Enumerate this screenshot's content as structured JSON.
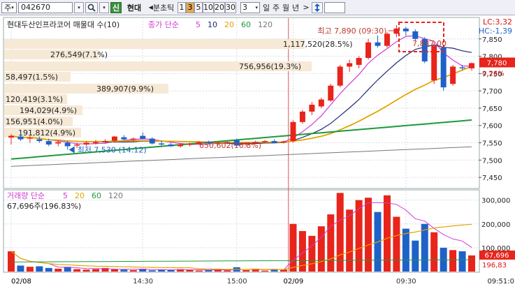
{
  "toolbar": {
    "market": "주",
    "code": "042670",
    "stock_name": "현대",
    "period_label": "분초틱",
    "intervals": [
      "1",
      "3",
      "5",
      "10",
      "20",
      "30"
    ],
    "active_interval": "3",
    "count_value": "3",
    "periods": [
      "일",
      "주",
      "월",
      "년"
    ],
    "more": ">",
    "sort_icon": "updown-arrows-icon",
    "credit_badge": "신",
    "prev_arrow": "◀"
  },
  "legend": {
    "title": "현대두산인프라코어 매물대 수(10)",
    "price_ma_label": "종가 단순",
    "price_ma_periods": [
      "5",
      "10",
      "20",
      "60",
      "120"
    ],
    "volume_label": "거래량 단순",
    "volume_ma_periods": [
      "5",
      "20",
      "60",
      "120"
    ],
    "volume_value": "67,696주(196.83%)"
  },
  "corner": {
    "lc": "LC:3,32",
    "hc": "HC:-1,39"
  },
  "annotations": {
    "high": "최고 7,890 (09:30)",
    "low": "최저 7,530 (14:12)",
    "current_price": "7,780",
    "current_change": "0.26%",
    "current_volume": "67,696",
    "volume_pct": "196,83",
    "big_label": "650,602(16.8%)",
    "high_box_label": "7,837.00"
  },
  "volume_profile": [
    {
      "label": "1,117,520(28.5%)"
    },
    {
      "label": "276,549(7.1%)"
    },
    {
      "label": "756,956(19.3%)"
    },
    {
      "label": "58,497(1.5%)"
    },
    {
      "label": "389,907(9.9%)"
    },
    {
      "label": "120,419(3.1%)"
    },
    {
      "label": "194,029(4.9%)"
    },
    {
      "label": "156,951(4.0%)"
    },
    {
      "label": "191,812(4.9%)"
    }
  ],
  "price_axis": [
    "7,850",
    "7,800",
    "7,750",
    "7,700",
    "7,650",
    "7,600",
    "7,550",
    "7,500",
    "7,450"
  ],
  "volume_axis": [
    "300,000",
    "200,000",
    "100,000"
  ],
  "time_axis": [
    "02/08",
    "14:30",
    "15:00",
    "02/09",
    "09:30",
    "09:51:0"
  ],
  "colors": {
    "up": "#e8241b",
    "down": "#1e62c8",
    "ma5": "#d23bd2",
    "ma10": "#1b2a7a",
    "ma20": "#e2a400",
    "ma60": "#1d9a3a",
    "ma120": "#777777",
    "profile": "#f6e9d6",
    "current_box": "#e8241b"
  },
  "chart_data": {
    "type": "candlestick",
    "candles": [
      {
        "o": 7565,
        "h": 7575,
        "l": 7545,
        "c": 7570
      },
      {
        "o": 7568,
        "h": 7578,
        "l": 7555,
        "c": 7560
      },
      {
        "o": 7562,
        "h": 7570,
        "l": 7550,
        "c": 7565
      },
      {
        "o": 7560,
        "h": 7568,
        "l": 7550,
        "c": 7555
      },
      {
        "o": 7555,
        "h": 7562,
        "l": 7540,
        "c": 7545
      },
      {
        "o": 7548,
        "h": 7558,
        "l": 7540,
        "c": 7552
      },
      {
        "o": 7550,
        "h": 7556,
        "l": 7530,
        "c": 7540
      },
      {
        "o": 7542,
        "h": 7550,
        "l": 7535,
        "c": 7545
      },
      {
        "o": 7545,
        "h": 7555,
        "l": 7540,
        "c": 7550
      },
      {
        "o": 7550,
        "h": 7558,
        "l": 7545,
        "c": 7552
      },
      {
        "o": 7552,
        "h": 7560,
        "l": 7548,
        "c": 7555
      },
      {
        "o": 7556,
        "h": 7570,
        "l": 7550,
        "c": 7568
      },
      {
        "o": 7566,
        "h": 7572,
        "l": 7558,
        "c": 7560
      },
      {
        "o": 7560,
        "h": 7565,
        "l": 7555,
        "c": 7562
      },
      {
        "o": 7570,
        "h": 7580,
        "l": 7560,
        "c": 7562
      },
      {
        "o": 7562,
        "h": 7566,
        "l": 7545,
        "c": 7548
      },
      {
        "o": 7548,
        "h": 7556,
        "l": 7540,
        "c": 7545
      },
      {
        "o": 7545,
        "h": 7550,
        "l": 7538,
        "c": 7540
      },
      {
        "o": 7540,
        "h": 7548,
        "l": 7536,
        "c": 7545
      },
      {
        "o": 7545,
        "h": 7550,
        "l": 7540,
        "c": 7547
      },
      {
        "o": 7547,
        "h": 7555,
        "l": 7545,
        "c": 7552
      },
      {
        "o": 7552,
        "h": 7556,
        "l": 7546,
        "c": 7548
      },
      {
        "o": 7548,
        "h": 7552,
        "l": 7544,
        "c": 7550
      },
      {
        "o": 7550,
        "h": 7555,
        "l": 7546,
        "c": 7552
      },
      {
        "o": 7558,
        "h": 7562,
        "l": 7540,
        "c": 7542
      },
      {
        "o": 7545,
        "h": 7552,
        "l": 7540,
        "c": 7550
      },
      {
        "o": 7550,
        "h": 7556,
        "l": 7546,
        "c": 7552
      },
      {
        "o": 7552,
        "h": 7558,
        "l": 7548,
        "c": 7555
      },
      {
        "o": 7555,
        "h": 7560,
        "l": 7548,
        "c": 7550
      },
      {
        "o": 7552,
        "h": 7556,
        "l": 7548,
        "c": 7554
      },
      {
        "o": 7555,
        "h": 7615,
        "l": 7550,
        "c": 7610
      },
      {
        "o": 7610,
        "h": 7645,
        "l": 7605,
        "c": 7640
      },
      {
        "o": 7640,
        "h": 7668,
        "l": 7630,
        "c": 7660
      },
      {
        "o": 7655,
        "h": 7680,
        "l": 7650,
        "c": 7675
      },
      {
        "o": 7672,
        "h": 7720,
        "l": 7668,
        "c": 7715
      },
      {
        "o": 7715,
        "h": 7775,
        "l": 7710,
        "c": 7770
      },
      {
        "o": 7770,
        "h": 7790,
        "l": 7755,
        "c": 7780
      },
      {
        "o": 7775,
        "h": 7800,
        "l": 7765,
        "c": 7795
      },
      {
        "o": 7795,
        "h": 7850,
        "l": 7790,
        "c": 7840
      },
      {
        "o": 7840,
        "h": 7860,
        "l": 7825,
        "c": 7830
      },
      {
        "o": 7830,
        "h": 7870,
        "l": 7825,
        "c": 7865
      },
      {
        "o": 7865,
        "h": 7890,
        "l": 7855,
        "c": 7880
      },
      {
        "o": 7880,
        "h": 7885,
        "l": 7860,
        "c": 7872
      },
      {
        "o": 7872,
        "h": 7878,
        "l": 7845,
        "c": 7850
      },
      {
        "o": 7850,
        "h": 7855,
        "l": 7780,
        "c": 7785
      },
      {
        "o": 7730,
        "h": 7840,
        "l": 7720,
        "c": 7830
      },
      {
        "o": 7825,
        "h": 7830,
        "l": 7700,
        "c": 7710
      },
      {
        "o": 7720,
        "h": 7775,
        "l": 7715,
        "c": 7770
      },
      {
        "o": 7768,
        "h": 7775,
        "l": 7760,
        "c": 7765
      },
      {
        "o": 7765,
        "h": 7782,
        "l": 7758,
        "c": 7780
      }
    ],
    "volumes": [
      85,
      25,
      20,
      22,
      15,
      12,
      20,
      10,
      8,
      10,
      15,
      9,
      8,
      6,
      12,
      5,
      8,
      6,
      10,
      8,
      4,
      6,
      9,
      5,
      18,
      6,
      12,
      4,
      10,
      8,
      200,
      170,
      150,
      190,
      240,
      330,
      260,
      300,
      310,
      250,
      320,
      230,
      180,
      130,
      200,
      165,
      100,
      90,
      85,
      67.696
    ],
    "ylim": [
      7420,
      7910
    ],
    "vol_ylim": [
      0,
      340
    ]
  }
}
